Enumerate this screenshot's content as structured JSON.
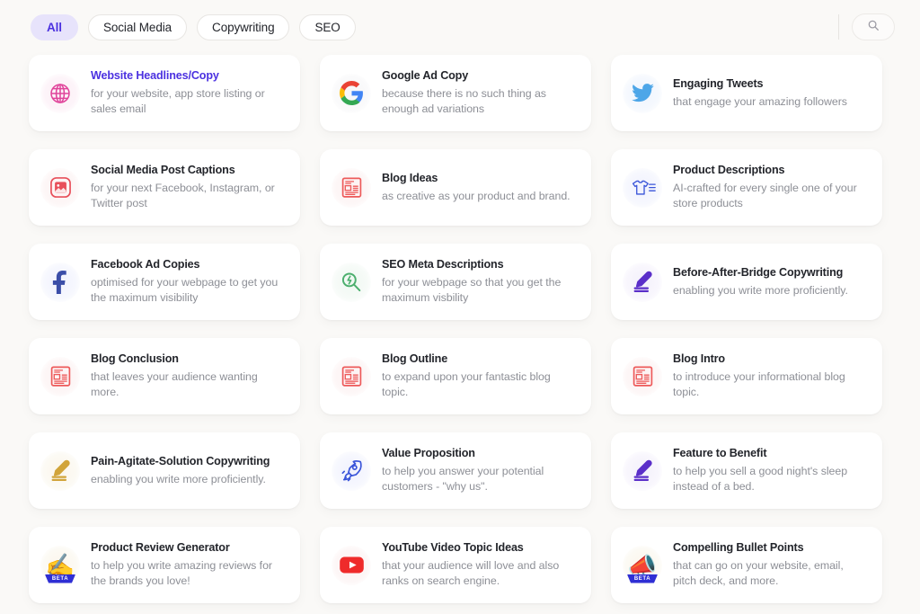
{
  "toolbar": {
    "filters": [
      {
        "label": "All",
        "active": true
      },
      {
        "label": "Social Media",
        "active": false
      },
      {
        "label": "Copywriting",
        "active": false
      },
      {
        "label": "SEO",
        "active": false
      }
    ],
    "search_icon": "search-icon",
    "accent_color": "#4b31e0",
    "active_pill_bg": "#e7e3fb"
  },
  "cards": [
    {
      "title": "Website Headlines/Copy",
      "desc": "for your website, app store listing or sales email",
      "icon": "globe-icon",
      "icon_color": "#e0459b",
      "halo": "halo-pink",
      "selected": true,
      "beta": false
    },
    {
      "title": "Google Ad Copy",
      "desc": "because there is no such thing as enough ad variations",
      "icon": "google-logo-icon",
      "icon_color": "#4285f4",
      "halo": "halo-grey",
      "selected": false,
      "beta": false
    },
    {
      "title": "Engaging Tweets",
      "desc": "that engage your amazing followers",
      "icon": "twitter-bird-icon",
      "icon_color": "#4da6e8",
      "halo": "halo-blue",
      "selected": false,
      "beta": false
    },
    {
      "title": "Social Media Post Captions",
      "desc": "for your next Facebook, Instagram, or Twitter post",
      "icon": "image-photo-icon",
      "icon_color": "#e8505b",
      "halo": "halo-red",
      "selected": false,
      "beta": false
    },
    {
      "title": "Blog Ideas",
      "desc": "as creative as your product and brand.",
      "icon": "newspaper-article-icon",
      "icon_color": "#ed5a5a",
      "halo": "halo-red",
      "selected": false,
      "beta": false
    },
    {
      "title": "Product Descriptions",
      "desc": "AI-crafted for every single one of your store products",
      "icon": "tshirt-list-icon",
      "icon_color": "#3a55d9",
      "halo": "halo-indigo",
      "selected": false,
      "beta": false
    },
    {
      "title": "Facebook Ad Copies",
      "desc": "optimised for your webpage to get you the maximum visibility",
      "icon": "facebook-f-icon",
      "icon_color": "#3b4ea8",
      "halo": "halo-indigo",
      "selected": false,
      "beta": false
    },
    {
      "title": "SEO Meta Descriptions",
      "desc": "for your webpage so that you get the maximum visbility",
      "icon": "magnifier-bolt-icon",
      "icon_color": "#4caf6e",
      "halo": "halo-green",
      "selected": false,
      "beta": false
    },
    {
      "title": "Before-After-Bridge Copywriting",
      "desc": "enabling you write more proficiently.",
      "icon": "pen-underline-icon",
      "icon_color": "#5b2fc9",
      "halo": "halo-purple",
      "selected": false,
      "beta": false
    },
    {
      "title": "Blog Conclusion",
      "desc": "that leaves your audience wanting more.",
      "icon": "newspaper-article-icon",
      "icon_color": "#ed5a5a",
      "halo": "halo-red",
      "selected": false,
      "beta": false
    },
    {
      "title": "Blog Outline",
      "desc": "to expand upon your fantastic blog topic.",
      "icon": "newspaper-article-icon",
      "icon_color": "#ed5a5a",
      "halo": "halo-red",
      "selected": false,
      "beta": false
    },
    {
      "title": "Blog Intro",
      "desc": "to introduce your informational blog topic.",
      "icon": "newspaper-article-icon",
      "icon_color": "#ed5a5a",
      "halo": "halo-red",
      "selected": false,
      "beta": false
    },
    {
      "title": "Pain-Agitate-Solution Copywriting",
      "desc": "enabling you write more proficiently.",
      "icon": "pen-underline-icon",
      "icon_color": "#d1a43a",
      "halo": "halo-gold",
      "selected": false,
      "beta": false
    },
    {
      "title": "Value Proposition",
      "desc": "to help you answer your potential customers - \"why us\".",
      "icon": "rocket-icon",
      "icon_color": "#3a55d9",
      "halo": "halo-indigo",
      "selected": false,
      "beta": false
    },
    {
      "title": "Feature to Benefit",
      "desc": "to help you sell a good night's sleep instead of a bed.",
      "icon": "pen-underline-icon",
      "icon_color": "#5b2fc9",
      "halo": "halo-purple",
      "selected": false,
      "beta": false
    },
    {
      "title": "Product Review Generator",
      "desc": "to help you write amazing reviews for the brands you love!",
      "icon": "writing-hand-icon",
      "icon_color": "#d1a43a",
      "halo": "halo-gold",
      "selected": false,
      "beta": true,
      "beta_label": "BETA"
    },
    {
      "title": "YouTube Video Topic Ideas",
      "desc": "that your audience will love and also ranks on search engine.",
      "icon": "youtube-play-icon",
      "icon_color": "#ef2b2b",
      "halo": "halo-red",
      "selected": false,
      "beta": false
    },
    {
      "title": "Compelling Bullet Points",
      "desc": "that can go on your website, email, pitch deck, and more.",
      "icon": "megaphone-icon",
      "icon_color": "#d1a43a",
      "halo": "halo-gold",
      "selected": false,
      "beta": true,
      "beta_label": "BETA"
    }
  ]
}
